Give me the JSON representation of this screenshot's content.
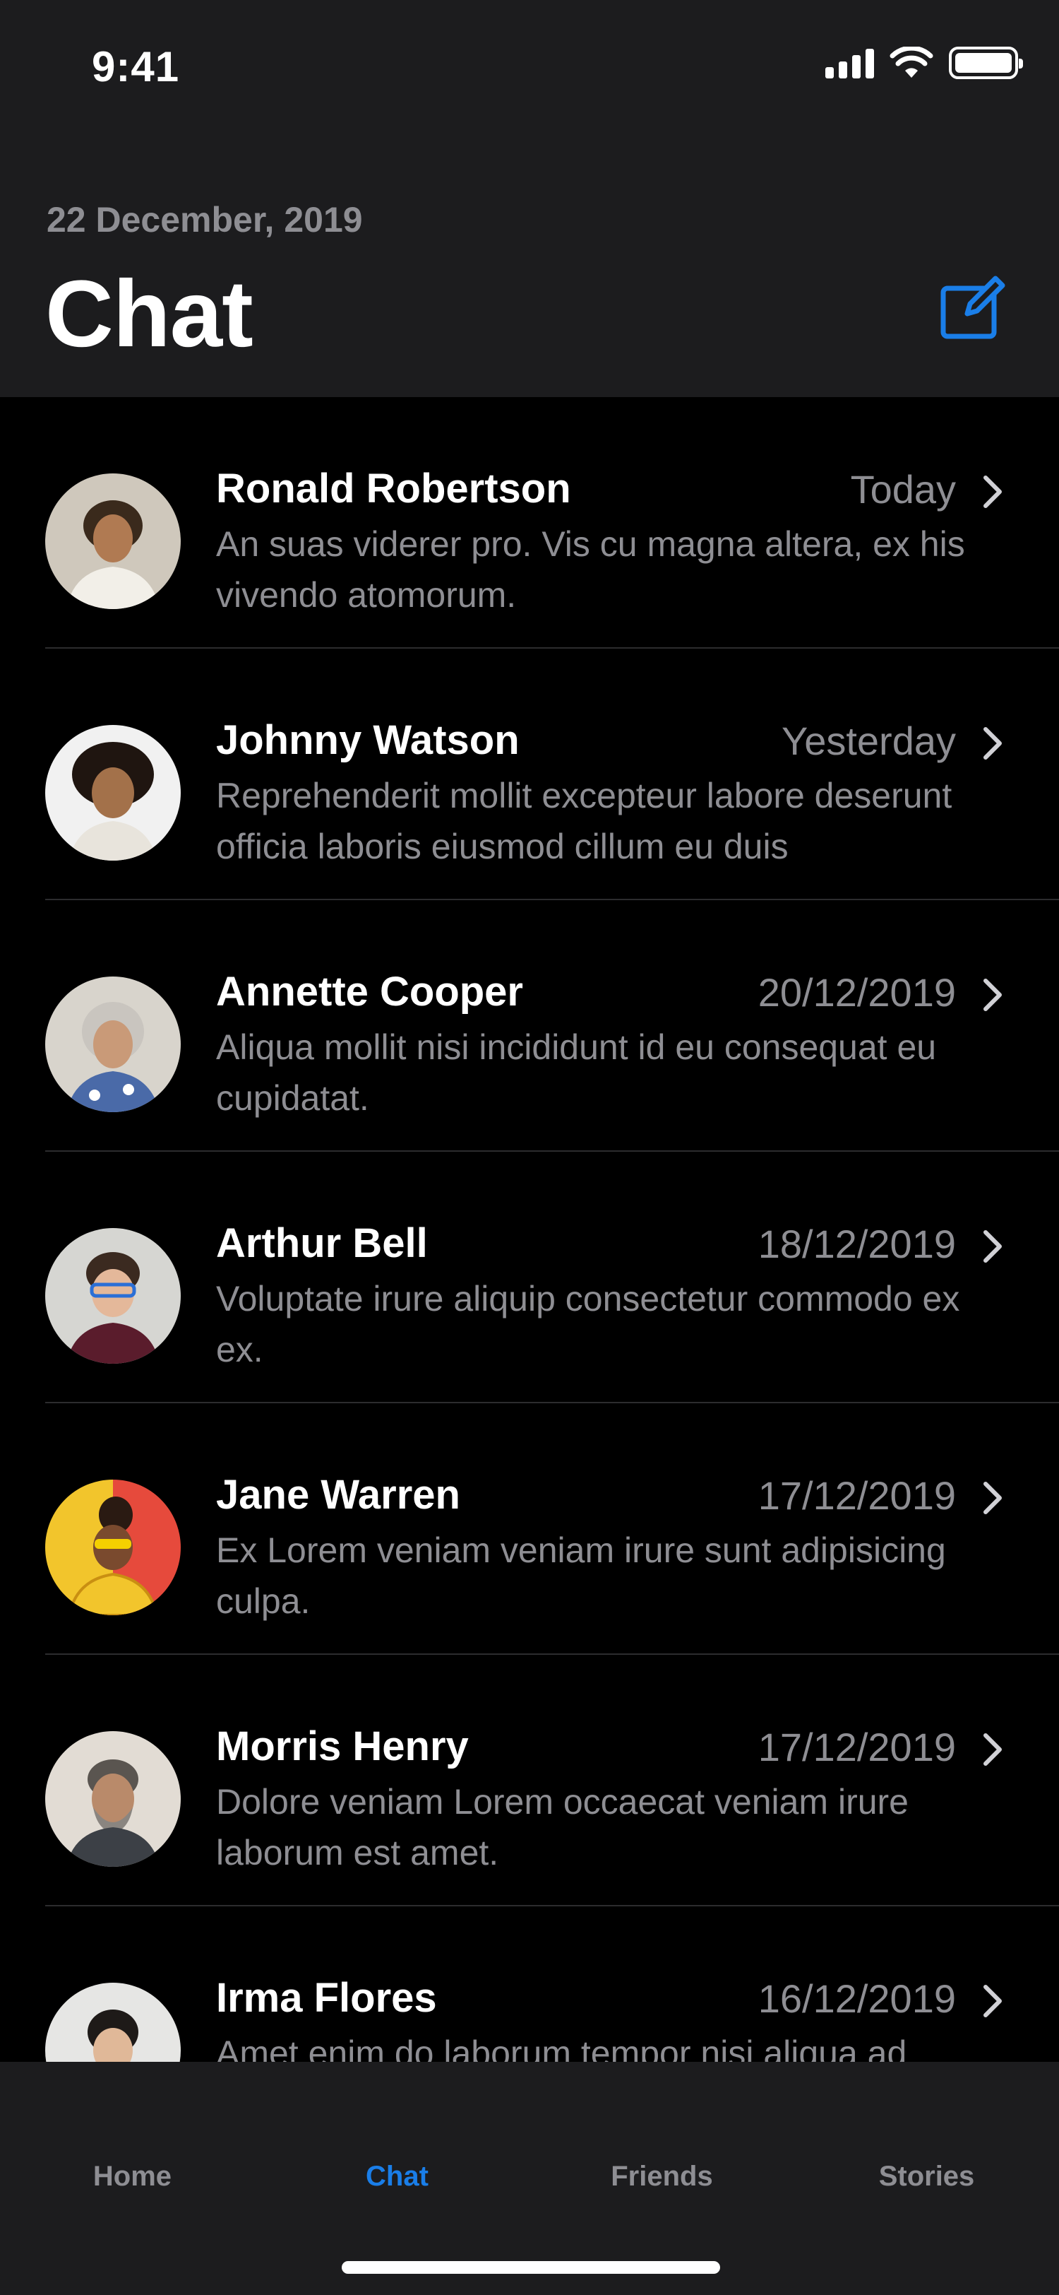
{
  "status_bar": {
    "time": "9:41"
  },
  "header": {
    "date": "22 December, 2019",
    "title": "Chat"
  },
  "chats": [
    {
      "name": "Ronald Robertson",
      "date": "Today",
      "preview": "An suas viderer pro. Vis cu magna altera, ex his vivendo atomorum."
    },
    {
      "name": "Johnny Watson",
      "date": "Yesterday",
      "preview": "Reprehenderit mollit excepteur labore deserunt officia laboris eiusmod cillum eu duis"
    },
    {
      "name": "Annette Cooper",
      "date": "20/12/2019",
      "preview": "Aliqua mollit nisi incididunt id eu consequat eu cupidatat."
    },
    {
      "name": "Arthur Bell",
      "date": "18/12/2019",
      "preview": "Voluptate irure aliquip consectetur commodo ex ex."
    },
    {
      "name": "Jane Warren",
      "date": "17/12/2019",
      "preview": "Ex Lorem veniam veniam irure sunt adipisicing culpa."
    },
    {
      "name": "Morris Henry",
      "date": "17/12/2019",
      "preview": "Dolore veniam Lorem occaecat veniam irure laborum est amet."
    },
    {
      "name": "Irma Flores",
      "date": "16/12/2019",
      "preview": "Amet enim do laborum tempor nisi aliqua ad"
    }
  ],
  "tabs": [
    {
      "label": "Home",
      "active": false
    },
    {
      "label": "Chat",
      "active": true
    },
    {
      "label": "Friends",
      "active": false
    },
    {
      "label": "Stories",
      "active": false
    }
  ],
  "colors": {
    "accent": "#1a7ee8",
    "background": "#000000",
    "bar": "#1c1c1e",
    "secondary_text": "#8e8e93"
  },
  "icons": {
    "compose": "compose-icon",
    "chevron": "chevron-right-icon",
    "wifi": "wifi-icon",
    "signal": "signal-icon",
    "battery": "battery-icon"
  }
}
